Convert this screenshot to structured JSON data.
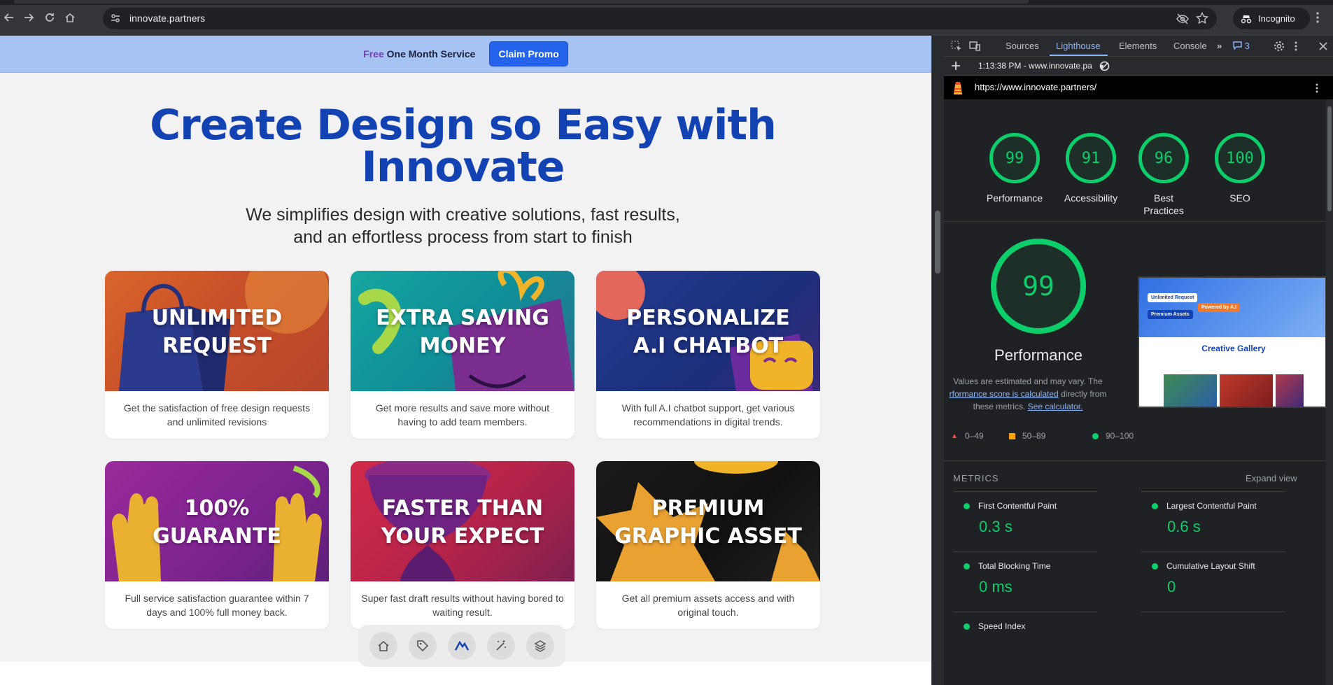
{
  "browser": {
    "url": "innovate.partners",
    "incognito_label": "Incognito"
  },
  "site": {
    "promo": {
      "free": "Free",
      "rest": "One Month Service",
      "claim": "Claim Promo"
    },
    "hero": {
      "title_line1": "Create Design so Easy with",
      "title_line2": "Innovate",
      "subtitle_line1": "We simplifies design with creative solutions, fast results,",
      "subtitle_line2": "and an effortless process from start to finish"
    },
    "cards": [
      {
        "title1": "UNLIMITED",
        "title2": "REQUEST",
        "desc": "Get the satisfaction of free design requests and unlimited revisions"
      },
      {
        "title1": "EXTRA SAVING",
        "title2": "MONEY",
        "desc": "Get more results and save more without having to add team members."
      },
      {
        "title1": "PERSONALIZE",
        "title2": "A.I CHATBOT",
        "desc": "With full A.I chatbot support, get various recommendations in digital trends."
      },
      {
        "title1": "100%",
        "title2": "GUARANTE",
        "desc": "Full service satisfaction guarantee within 7 days and 100% full money back."
      },
      {
        "title1": "FASTER THAN",
        "title2": "YOUR EXPECT",
        "desc": "Super fast draft results without having bored to waiting result."
      },
      {
        "title1": "PREMIUM",
        "title2": "GRAPHIC ASSET",
        "desc": "Get all premium assets access and with original touch."
      }
    ],
    "dock_icons": [
      "home-icon",
      "tag-icon",
      "brand-logo-icon",
      "magic-wand-icon",
      "layers-icon"
    ]
  },
  "devtools": {
    "tabs": [
      "Sources",
      "Lighthouse",
      "Elements",
      "Console"
    ],
    "active_tab": "Lighthouse",
    "issues_count": "3",
    "report_time": "1:13:38 PM - www.innovate.pa",
    "report_url": "https://www.innovate.partners/",
    "scores": [
      {
        "value": "99",
        "label": "Performance"
      },
      {
        "value": "91",
        "label": "Accessibility"
      },
      {
        "value": "96",
        "label": "Best Practices"
      },
      {
        "value": "100",
        "label": "SEO"
      }
    ],
    "performance": {
      "score": "99",
      "title": "Performance",
      "note_prefix": "Values are estimated and may vary. The",
      "note_link": "rformance score is calculated",
      "note_mid": "directly from these metrics.",
      "note_link2": "See calculator."
    },
    "legend": [
      "0–49",
      "50–89",
      "90–100"
    ],
    "screenshot": {
      "heading": "Creative Gallery",
      "tag1": "Unlimited Request",
      "tag2": "Premium Assets",
      "tag3": "Powered by A.I"
    },
    "metrics_header": "METRICS",
    "expand_label": "Expand view",
    "metrics": [
      {
        "name": "First Contentful Paint",
        "value": "0.3 s"
      },
      {
        "name": "Largest Contentful Paint",
        "value": "0.6 s"
      },
      {
        "name": "Total Blocking Time",
        "value": "0 ms"
      },
      {
        "name": "Cumulative Layout Shift",
        "value": "0"
      },
      {
        "name": "Speed Index",
        "value": ""
      }
    ],
    "colors": {
      "pass": "#0cce6b",
      "average": "#ffa400",
      "fail": "#ff4e42",
      "link": "#8ab4f8"
    }
  }
}
